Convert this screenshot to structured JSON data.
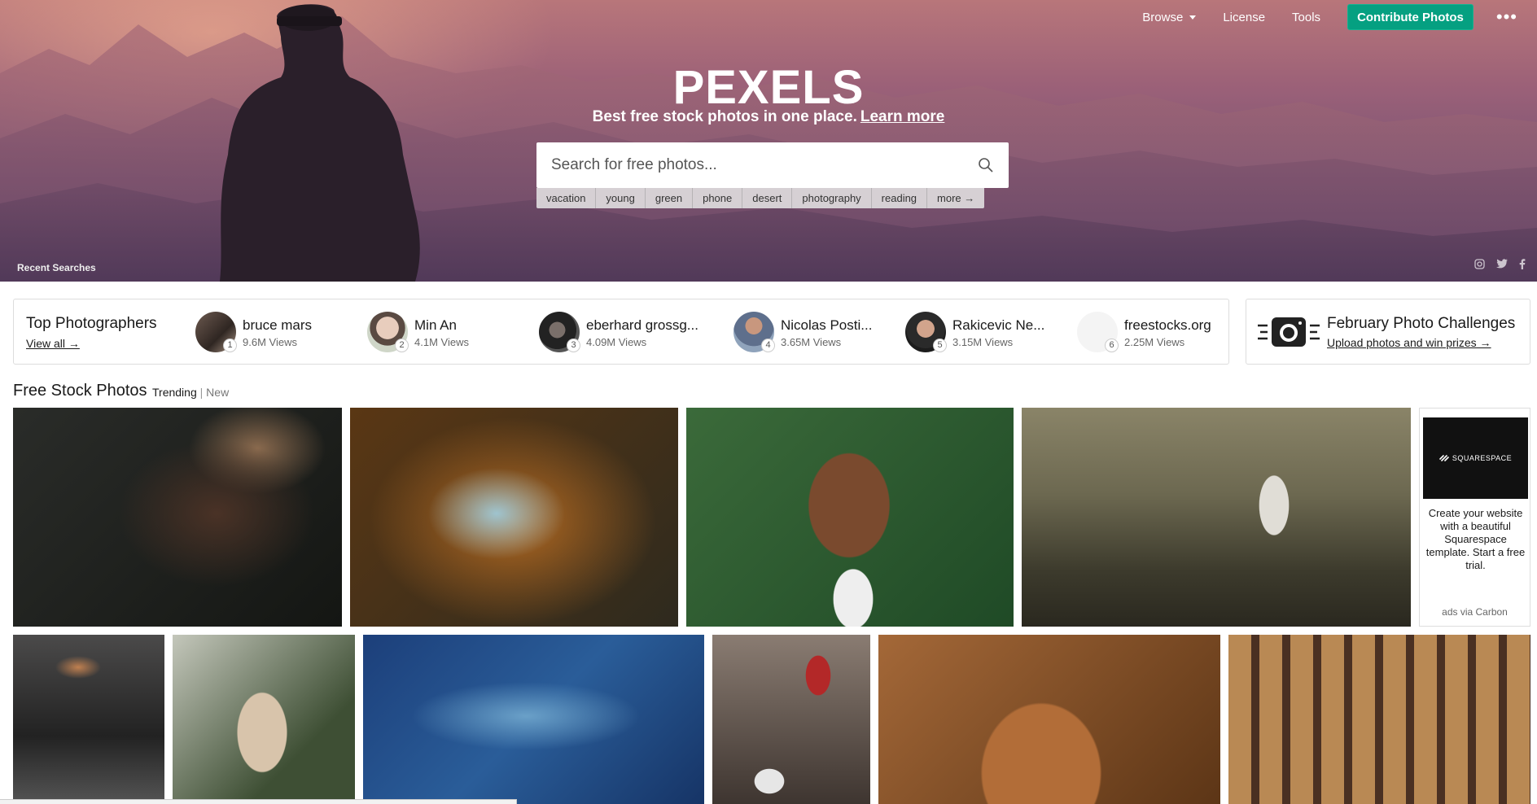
{
  "nav": {
    "browse": "Browse",
    "license": "License",
    "tools": "Tools",
    "contribute": "Contribute Photos",
    "more": "•••"
  },
  "hero": {
    "logo": "PEXELS",
    "tagline": "Best free stock photos in one place.",
    "learn_more": "Learn more",
    "search_placeholder": "Search for free photos...",
    "tags": [
      "vacation",
      "young",
      "green",
      "phone",
      "desert",
      "photography",
      "reading",
      "more →"
    ],
    "recent_searches": "Recent Searches",
    "socials": [
      "instagram-icon",
      "twitter-icon",
      "facebook-icon"
    ]
  },
  "top_photographers": {
    "title": "Top Photographers",
    "view_all": "View all →",
    "list": [
      {
        "name": "bruce mars",
        "views": "9.6M Views",
        "rank": "1"
      },
      {
        "name": "Min An",
        "views": "4.1M Views",
        "rank": "2"
      },
      {
        "name": "eberhard grossg...",
        "views": "4.09M Views",
        "rank": "3"
      },
      {
        "name": "Nicolas Posti...",
        "views": "3.65M Views",
        "rank": "4"
      },
      {
        "name": "Rakicevic Ne...",
        "views": "3.15M Views",
        "rank": "5"
      },
      {
        "name": "freestocks.org",
        "views": "2.25M Views",
        "rank": "6"
      }
    ]
  },
  "challenge": {
    "title": "February Photo Challenges",
    "link": "Upload photos and win prizes →"
  },
  "feed": {
    "title": "Free Stock Photos",
    "tab_trending": "Trending",
    "separator": "|",
    "tab_new": "New"
  },
  "ad": {
    "brand": "SQUARESPACE",
    "text": "Create your website with a beautiful Squarespace template. Start a free trial.",
    "via": "ads via Carbon"
  },
  "colors": {
    "accent": "#05a081",
    "hero_top": "#b8767a",
    "hero_bottom": "#6a4a6e"
  }
}
